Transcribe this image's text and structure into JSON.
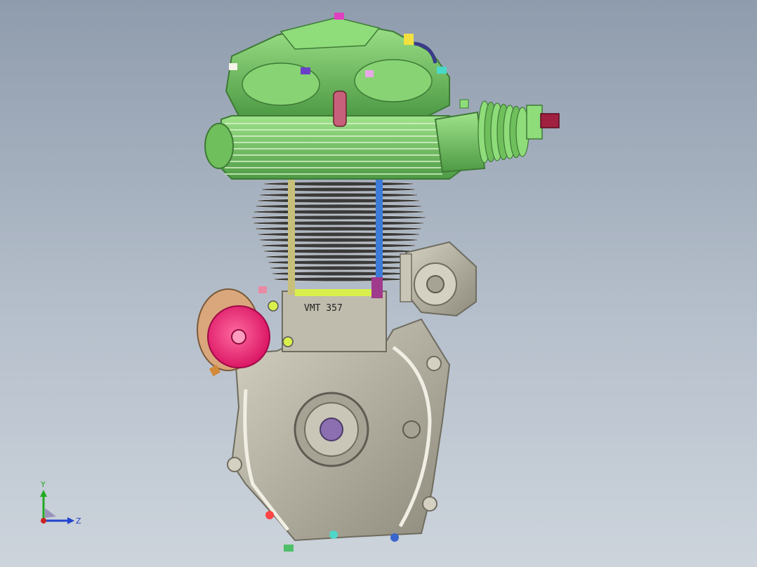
{
  "viewport": {
    "background_top": "#8f9cad",
    "background_bottom": "#cdd4dc"
  },
  "model": {
    "engraved_text": "VMT 357",
    "colors": {
      "cylinder_head": "#7ccf6a",
      "cylinder_head_shadow": "#4e9a45",
      "crankcase": "#b9b6a6",
      "crankcase_shadow": "#8e8b7d",
      "cooling_fins": "#2b2b2b",
      "magneto_rotor": "#ff2f7a",
      "magneto_housing": "#d9a77b",
      "pushrod_left": "#c8c07a",
      "pushrod_right": "#3c7bd8",
      "crank_hub": "#8b6fb0"
    }
  },
  "triad": {
    "y_label": "Y",
    "z_label": "Z",
    "y_color": "#22aa22",
    "z_color": "#2244cc",
    "x_color": "#cc2222"
  }
}
